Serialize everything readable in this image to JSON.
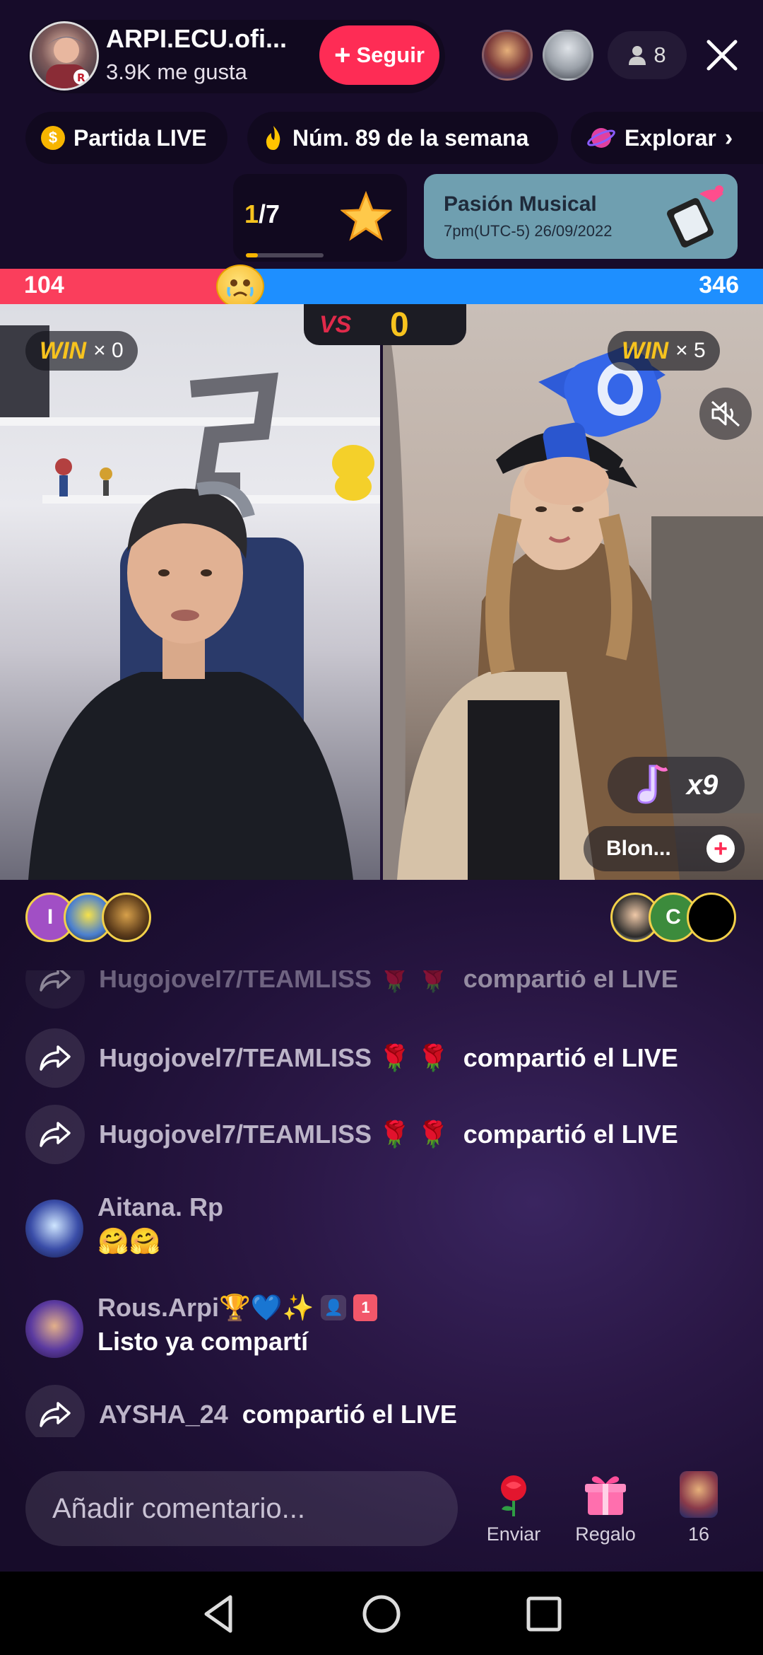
{
  "header": {
    "host_name": "ARPI.ECU.ofi...",
    "likes": "3.9K me gusta",
    "follow_label": "Seguir",
    "viewer_count": "8"
  },
  "pills": [
    {
      "label": "Partida LIVE",
      "icon": "coin-icon"
    },
    {
      "label": "Núm. 89 de la semana",
      "icon": "flame-icon"
    },
    {
      "label": "Explorar",
      "icon": "planet-icon"
    }
  ],
  "rank": {
    "current": "1",
    "total": "/7",
    "progress": 0.15
  },
  "event_banner": {
    "title": "Pasión Musical",
    "date": "7pm(UTC-5) 26/09/2022"
  },
  "battle": {
    "left_score": "104",
    "right_score": "346",
    "vs_label": "VS",
    "center_score": "0",
    "left_win_word": "WIN",
    "left_win": "× 0",
    "right_win_word": "WIN",
    "right_win": "× 5",
    "combo": "x9",
    "guest_name": " Blon..."
  },
  "supporters": {
    "left_initial": "I",
    "right_initial": "C"
  },
  "chat": [
    {
      "type": "share",
      "user": "Hugojovel7/TEAMLISS 🌹 🌹",
      "message": "compartió el LIVE"
    },
    {
      "type": "share",
      "user": "Hugojovel7/TEAMLISS 🌹 🌹",
      "message": "compartió el LIVE"
    },
    {
      "type": "share",
      "user": "Hugojovel7/TEAMLISS 🌹 🌹",
      "message": "compartió el LIVE"
    },
    {
      "type": "comment",
      "user": "Aitana. Rp",
      "message": "🤗🤗"
    },
    {
      "type": "comment",
      "user": "Rous.Arpi🏆💙✨",
      "message": "Listo ya compartí"
    },
    {
      "type": "share",
      "user": "AYSHA_24",
      "message": "compartió el LIVE"
    }
  ],
  "bottom": {
    "comment_placeholder": "Añadir comentario...",
    "send_label": "Enviar",
    "gift_label": "Regalo",
    "count_label": "16"
  },
  "colors": {
    "accent": "#fe2c55",
    "team_red": "#fa3e5c",
    "team_blue": "#1e8fff",
    "gold": "#f7c31e"
  }
}
